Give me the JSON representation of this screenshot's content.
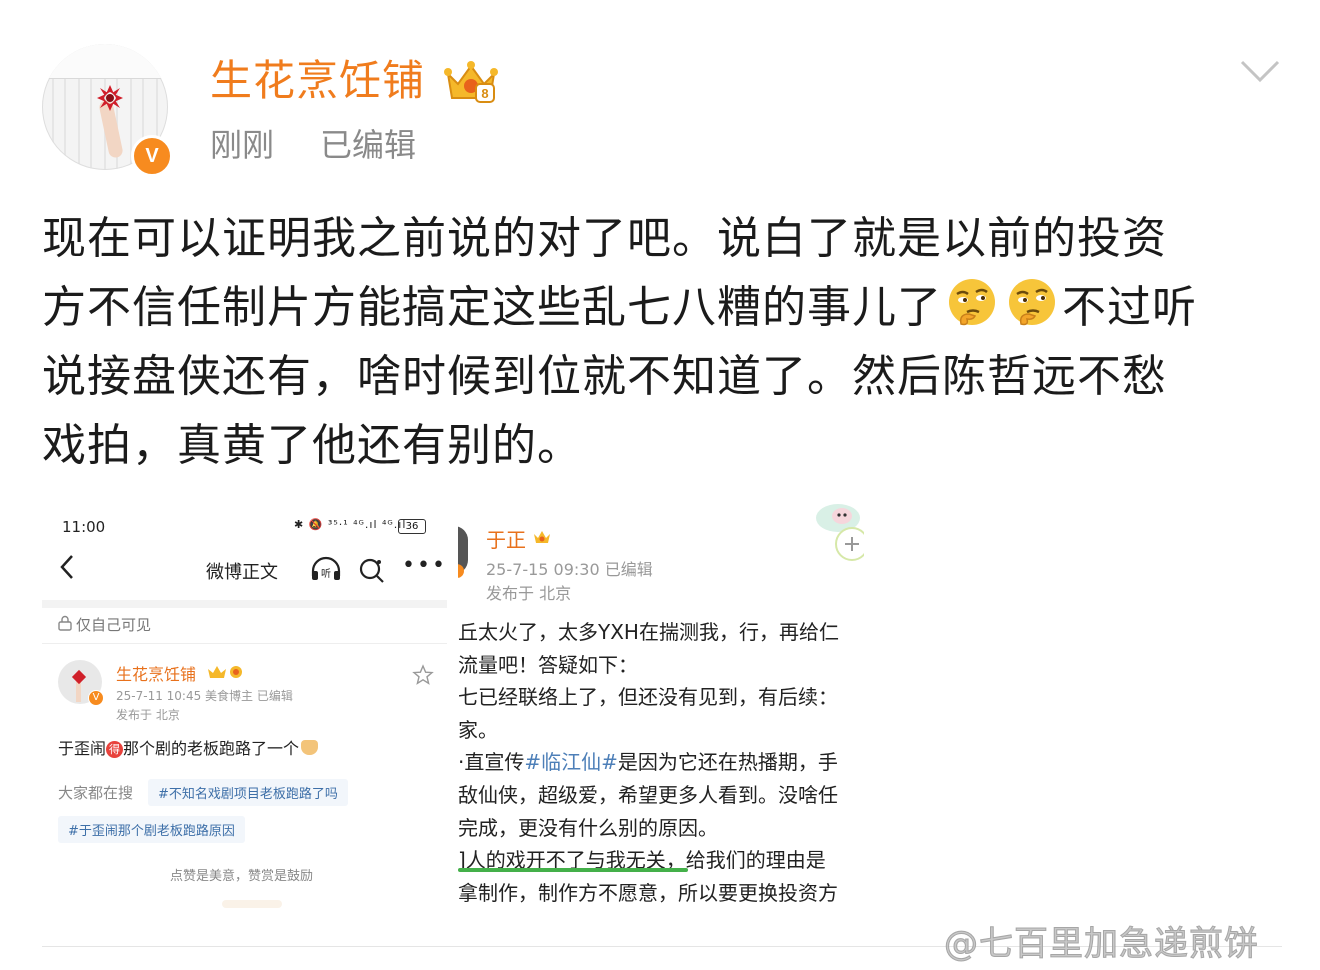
{
  "post": {
    "author": "生花烹饪铺",
    "time": "刚刚",
    "edited": "已编辑",
    "lines": [
      "现在可以证明我之前说的对了吧。说白了就是以前的投资",
      "方不信任制片方能搞定这些乱七八糟的事儿了",
      "不过听",
      "说接盘侠还有，啥时候到位就不知道了。然后陈哲远不愁",
      "戏拍，真黄了他还有别的。"
    ],
    "emojis": [
      "thinking-face",
      "thinking-face"
    ]
  },
  "left_shot": {
    "status_time": "11:00",
    "status_icons": "✱ 🔕 ³⁵·¹ ⁴ᴳ.ıl ⁴ᴳ.ıl",
    "battery": "36",
    "nav_title": "微博正文",
    "visibility": "仅自己可见",
    "author": "生花烹饪铺",
    "meta": "25-7-11 10:45  美食博主  已编辑",
    "location": "发布于 北京",
    "body_pre": "于歪闹",
    "body_tag": "得",
    "body_post": "那个剧的老板跑路了一个",
    "search_label": "大家都在搜",
    "search_pill_1": "#不知名戏剧项目老板跑路了吗",
    "search_pill_2": "#于歪闹那个剧老板跑路原因",
    "footer": "点赞是美意，赞赏是鼓励"
  },
  "right_shot": {
    "author": "于正",
    "meta": "25-7-15 09:30   已编辑",
    "location": "发布于 北京",
    "body": [
      [
        "丘太火了，太多YXH在揣测我，行，再给仁"
      ],
      [
        "流量吧！答疑如下："
      ],
      [
        "七已经联络上了，但还没有见到，有后续："
      ],
      [
        "家。"
      ],
      [
        "·直宣传",
        "#临江仙#",
        "是因为它还在热播期，手"
      ],
      [
        "敌仙侠，超级爱，希望更多人看到。没啥任"
      ],
      [
        "完成，更没有什么别的原因。"
      ],
      [
        "]人的戏开不了与我无关，给我们的理由是"
      ],
      [
        "拿制作，制作方不愿意，所以要更换投资方"
      ]
    ]
  },
  "watermark": "@七百里加急递煎饼",
  "colors": {
    "accent": "#f07c1d",
    "meta": "#8a8a8a",
    "link": "#4d7fb8",
    "vbadge": "#f78b1f"
  }
}
